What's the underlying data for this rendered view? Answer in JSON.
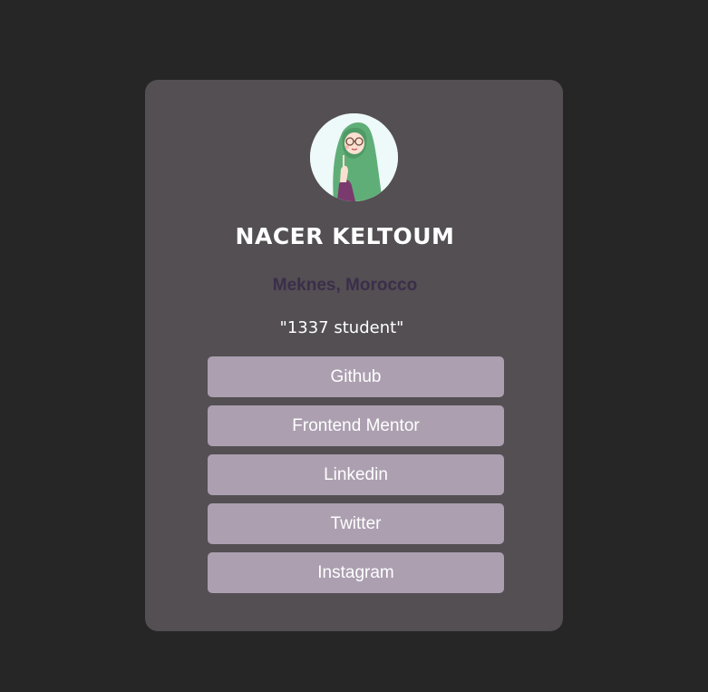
{
  "profile": {
    "name": "NACER KELTOUM",
    "location": "Meknes, Morocco",
    "bio": "\"1337 student\"",
    "avatar_icon": "hijab-girl-avatar"
  },
  "links": [
    {
      "label": "Github"
    },
    {
      "label": "Frontend Mentor"
    },
    {
      "label": "Linkedin"
    },
    {
      "label": "Twitter"
    },
    {
      "label": "Instagram"
    }
  ],
  "colors": {
    "page_bg": "#262626",
    "card_bg": "#534f52",
    "button_bg": "#ab9fb0",
    "location_text": "#3b2e4a",
    "name_text": "#ffffff"
  }
}
